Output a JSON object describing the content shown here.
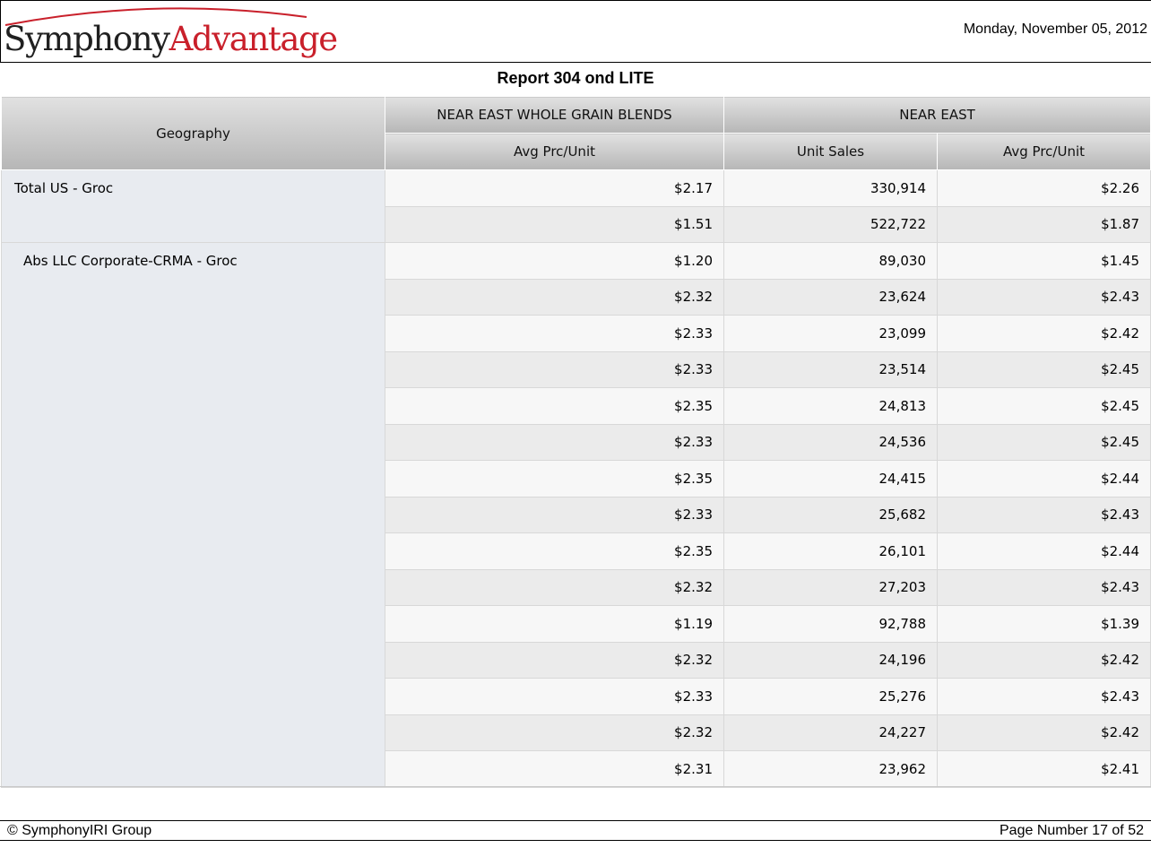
{
  "header": {
    "logo_part1": "Symphony",
    "logo_part2": "Advantage",
    "date": "Monday, November 05, 2012"
  },
  "report": {
    "title": "Report 304 ond LITE"
  },
  "table": {
    "geography_header": "Geography",
    "group1": "NEAR EAST WHOLE GRAIN BLENDS",
    "group2": "NEAR EAST",
    "col1": "Avg Prc/Unit",
    "col2": "Unit Sales",
    "col3": "Avg Prc/Unit",
    "geographies": [
      {
        "name": "Total US - Groc",
        "rows": [
          [
            "$2.17",
            "330,914",
            "$2.26"
          ],
          [
            "$1.51",
            "522,722",
            "$1.87"
          ]
        ]
      },
      {
        "name": "Abs LLC Corporate-CRMA - Groc",
        "rows": [
          [
            "$1.20",
            "89,030",
            "$1.45"
          ],
          [
            "$2.32",
            "23,624",
            "$2.43"
          ],
          [
            "$2.33",
            "23,099",
            "$2.42"
          ],
          [
            "$2.33",
            "23,514",
            "$2.45"
          ],
          [
            "$2.35",
            "24,813",
            "$2.45"
          ],
          [
            "$2.33",
            "24,536",
            "$2.45"
          ],
          [
            "$2.35",
            "24,415",
            "$2.44"
          ],
          [
            "$2.33",
            "25,682",
            "$2.43"
          ],
          [
            "$2.35",
            "26,101",
            "$2.44"
          ],
          [
            "$2.32",
            "27,203",
            "$2.43"
          ],
          [
            "$1.19",
            "92,788",
            "$1.39"
          ],
          [
            "$2.32",
            "24,196",
            "$2.42"
          ],
          [
            "$2.33",
            "25,276",
            "$2.43"
          ],
          [
            "$2.32",
            "24,227",
            "$2.42"
          ],
          [
            "$2.31",
            "23,962",
            "$2.41"
          ]
        ]
      }
    ]
  },
  "footer": {
    "copyright": "© SymphonyIRI Group",
    "page": "Page Number 17 of 52"
  }
}
